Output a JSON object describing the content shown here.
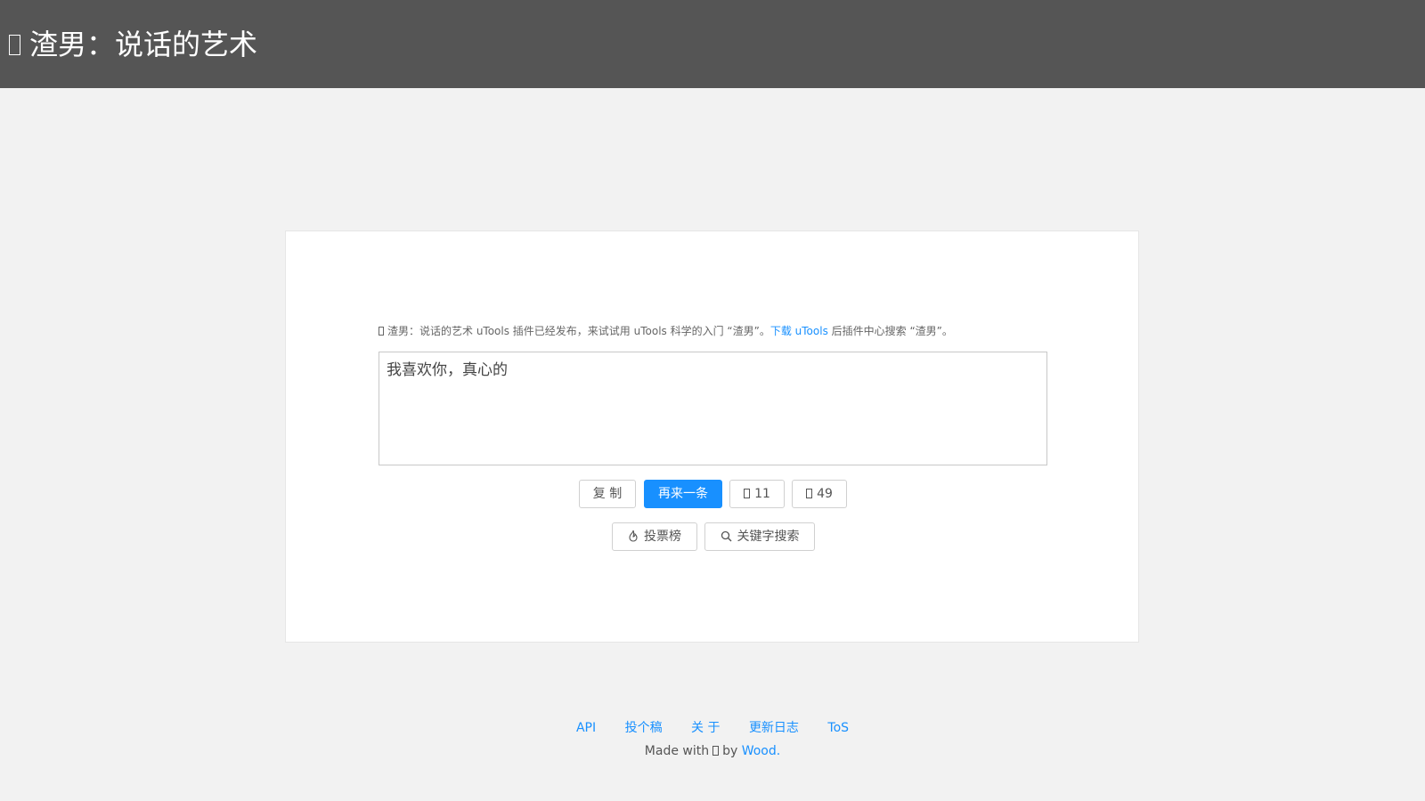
{
  "header": {
    "title": "渣男：说话的艺术",
    "title_icon": "boxed-glyph-icon"
  },
  "notice": {
    "prefix": "渣男：说话的艺术 uTools 插件已经发布，来试试用 uTools 科学的入门 “渣男”。",
    "link_label": "下载 uTools",
    "suffix": " 后插件中心搜索 “渣男”。",
    "icon": "boxed-glyph-icon"
  },
  "quote": {
    "text": "我喜欢你，真心的"
  },
  "actions": {
    "copy_label": "复 制",
    "next_label": "再来一条",
    "like_count": "11",
    "dislike_count": "49",
    "vote_rank_label": "投票榜",
    "keyword_search_label": "关键字搜索"
  },
  "footer": {
    "links": [
      "API",
      "投个稿",
      "关 于",
      "更新日志",
      "ToS"
    ],
    "made_with_prefix": "Made with",
    "made_with_by": "by",
    "author": "Wood."
  },
  "colors": {
    "header_bg": "#555555",
    "page_bg": "#f2f2f2",
    "accent": "#1890ff"
  }
}
